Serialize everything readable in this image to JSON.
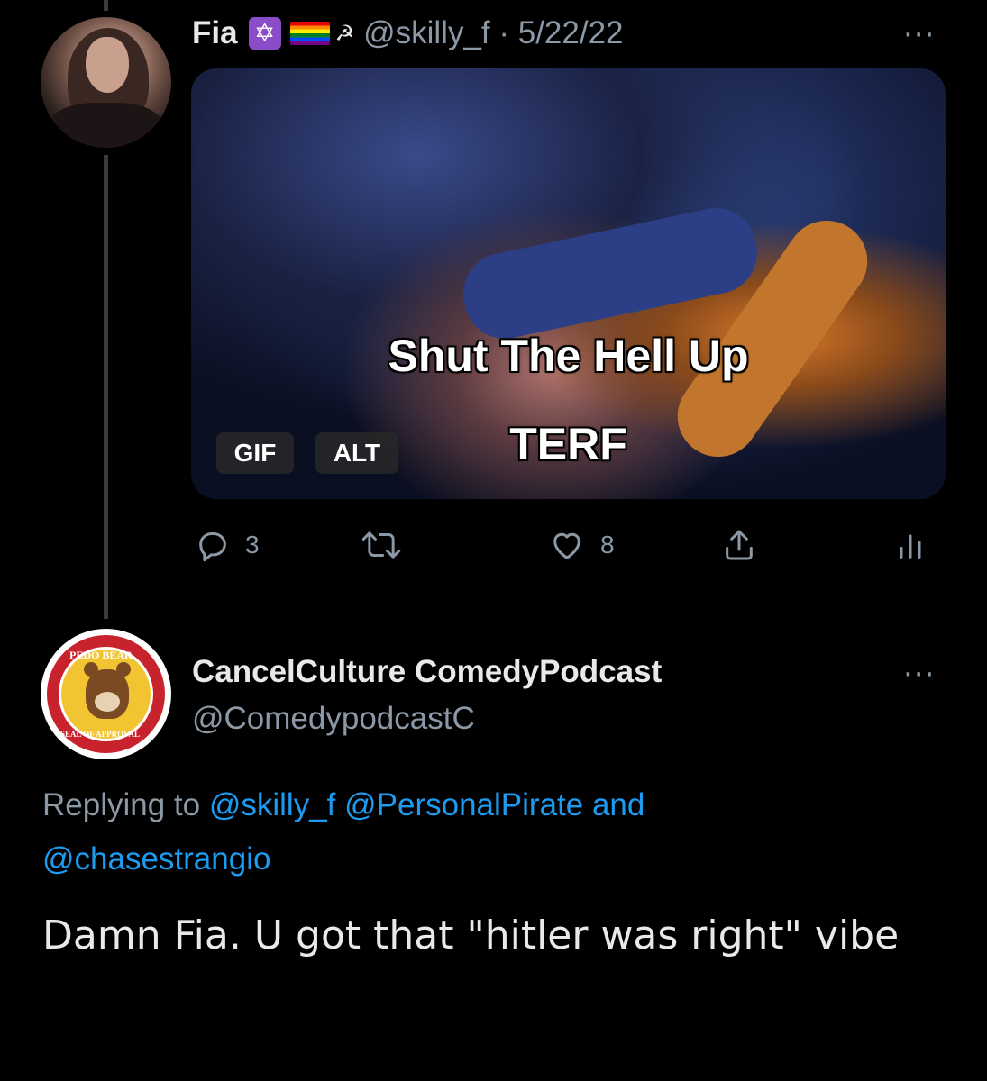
{
  "tweet1": {
    "name": "Fia",
    "emoji_star": "✡",
    "emoji_hammer": "☭",
    "handle_date": "@skilly_f · 5/22/22",
    "more": "···",
    "media": {
      "caption_line1": "Shut The Hell Up",
      "caption_line2": "TERF",
      "gif_badge": "GIF",
      "alt_badge": "ALT"
    },
    "actions": {
      "reply_count": "3",
      "like_count": "8"
    }
  },
  "tweet2": {
    "name": "CancelCulture ComedyPodcast",
    "handle": "@ComedypodcastC",
    "more": "···",
    "avatar_text_top": "PEDO BEAR",
    "avatar_text_bottom": "SEAL OF APPROVAL",
    "replying_prefix": "Replying to",
    "replying_user1": "@skilly_f",
    "replying_user2": "@PersonalPirate",
    "replying_and": "and",
    "replying_user3": "@chasestrangio",
    "text": "Damn Fia. U got that \"hitler was right\" vibe"
  },
  "colors": {
    "background": "#000000",
    "primary_text": "#e7e9ea",
    "secondary_text": "#8b98a5",
    "link": "#1d9bf0"
  }
}
